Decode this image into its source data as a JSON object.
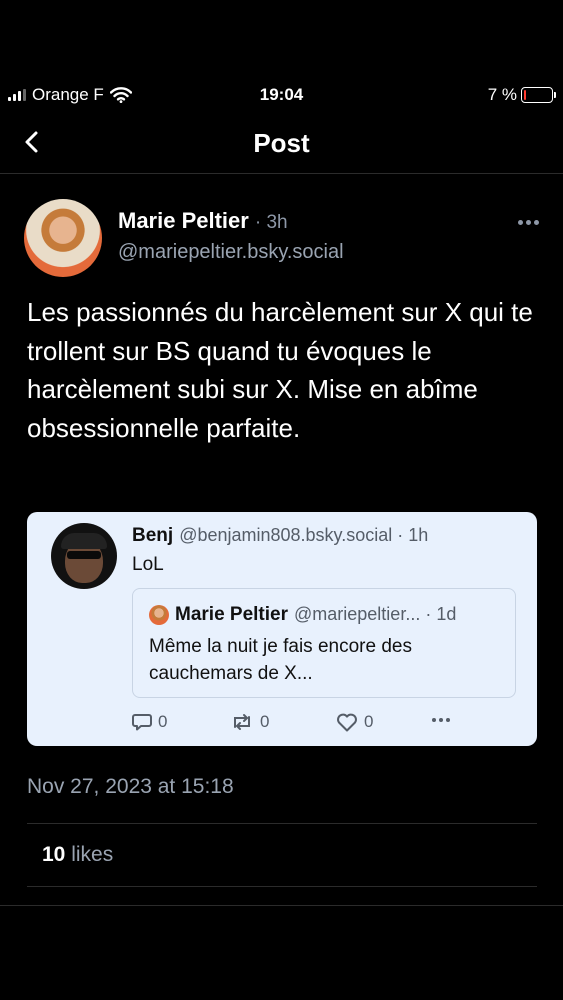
{
  "status_bar": {
    "carrier": "Orange F",
    "time": "19:04",
    "battery": "7 %",
    "battery_level": 0.07,
    "battery_color": "#ff3b30"
  },
  "header": {
    "title": "Post",
    "back_icon": "chevron-left-icon"
  },
  "post": {
    "author_name": "Marie Peltier",
    "time_ago": "· 3h",
    "handle": "@mariepeltier.bsky.social",
    "text": "Les passionnés du harcèlement sur X qui te trollent sur BS quand tu évoques le harcèlement subi sur X. Mise en abîme obsessionnelle parfaite.",
    "timestamp": "Nov 27, 2023 at 15:18",
    "likes_count": "10",
    "likes_label": "likes"
  },
  "embed": {
    "author_name": "Benj",
    "handle": "@benjamin808.bsky.social · 1h",
    "text": "LoL",
    "background": "#e8f1fd",
    "quote": {
      "author_name": "Marie Peltier",
      "handle": "@mariepeltier... · 1d",
      "text": "Même la nuit je fais encore des cauchemars de X..."
    },
    "actions": {
      "replies": "0",
      "reposts": "0",
      "likes": "0"
    }
  }
}
